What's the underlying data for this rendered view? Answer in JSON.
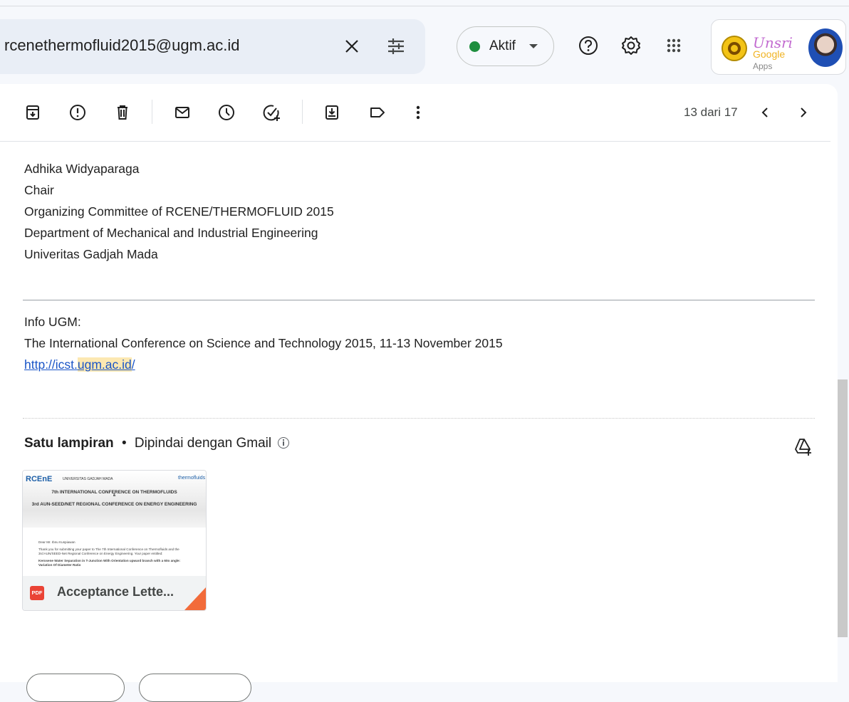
{
  "search": {
    "query": "rcenethermofluid2015@ugm.ac.id"
  },
  "status": {
    "label": "Aktif",
    "color": "#1e8e3e"
  },
  "logo": {
    "line1": "Unsri",
    "line2_a": "Google",
    "line2_b": "Apps"
  },
  "pager": {
    "text": "13 dari 17"
  },
  "signature": {
    "name": "Adhika Widyaparaga",
    "role": "Chair",
    "committee": "Organizing Committee of RCENE/THERMOFLUID 2015",
    "department": "Department of Mechanical and Industrial Engineering",
    "university": "Univeritas Gadjah Mada"
  },
  "info": {
    "heading": "Info UGM:",
    "line": "The International Conference on Science and Technology 2015, 11-13 November 2015",
    "link_prefix": "http://icst.",
    "link_highlight": "ugm.ac.id",
    "link_suffix": "/"
  },
  "attachments": {
    "heading": "Satu lampiran",
    "separator": "•",
    "scanned": "Dipindai dengan Gmail",
    "file_label": "Acceptance Lette...",
    "file_type": "PDF",
    "preview": {
      "logo": "RCEnE",
      "uni": "UNIVERSITAS GADJAH MADA",
      "brand": "thermofluids",
      "title1": "7th INTERNATIONAL CONFERENCE ON THERMOFLUIDS",
      "title2": "&",
      "title3": "3rd AUN-SEED/NET REGIONAL CONFERENCE ON ENERGY ENGINEERING",
      "greeting": "Dear Mr. Ibnu Kuspiawan",
      "text1": "Thank you for submitting your paper to The 7th International Conference on Thermofluids and the",
      "text2": "3rd AUN/SEED-Net Regional Conference on Energy Engineering. Your paper entitled:",
      "paper1": "Kerosene Water Separation in T-Junction With Orientation upward branch with a 60o angle:",
      "paper2": "Variation Of Diameter Ratio"
    }
  }
}
